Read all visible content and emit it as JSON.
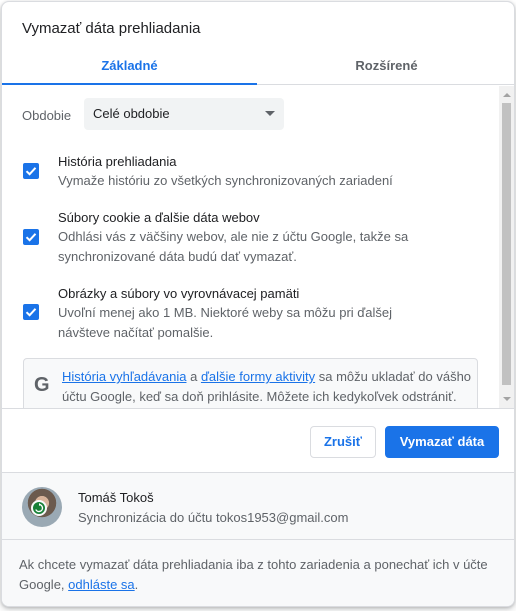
{
  "dialog": {
    "title": "Vymazať dáta prehliadania",
    "tabs": [
      {
        "label": "Základné",
        "active": true
      },
      {
        "label": "Rozšírené",
        "active": false
      }
    ]
  },
  "period": {
    "label": "Obdobie",
    "selected": "Celé obdobie"
  },
  "items": [
    {
      "checked": true,
      "title": "História prehliadania",
      "description": "Vymaže históriu zo všetkých synchronizovaných zariadení"
    },
    {
      "checked": true,
      "title": "Súbory cookie a ďalšie dáta webov",
      "description": "Odhlási vás z väčšiny webov, ale nie z účtu Google, takže sa synchronizované dáta budú dať vymazať."
    },
    {
      "checked": true,
      "title": "Obrázky a súbory vo vyrovnávacej pamäti",
      "description": "Uvoľní menej ako 1 MB. Niektoré weby sa môžu pri ďalšej návšteve načítať pomalšie."
    }
  ],
  "info": {
    "link1": "História vyhľadávania",
    "mid": " a ",
    "link2": "ďalšie formy aktivity",
    "rest": " sa môžu ukladať do vášho účtu Google, keď sa doň prihlásite. Môžete ich kedykoľvek odstrániť."
  },
  "buttons": {
    "cancel": "Zrušiť",
    "confirm": "Vymazať dáta"
  },
  "account": {
    "name": "Tomáš Tokoš",
    "sync_text": "Synchronizácia do účtu tokos1953@gmail.com"
  },
  "footer": {
    "text": "Ak chcete vymazať dáta prehliadania iba z tohto zariadenia a ponechať ich v účte Google, ",
    "link": "odhláste sa",
    "end": "."
  },
  "colors": {
    "accent": "#1a73e8",
    "sync_badge": "#188038"
  },
  "icons": {
    "checkbox": "check-icon",
    "google": "google-g-icon",
    "dropdown": "chevron-down-icon",
    "sync": "sync-icon"
  }
}
